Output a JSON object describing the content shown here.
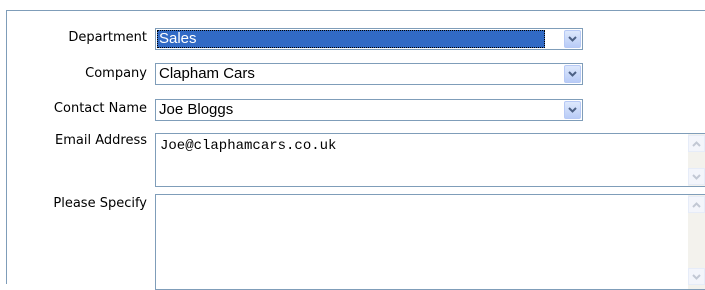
{
  "form": {
    "department": {
      "label": "Department",
      "value": "Sales",
      "selected_highlight": true,
      "dropdown_icon": "chevron-down-icon"
    },
    "company": {
      "label": "Company",
      "value": "Clapham Cars",
      "dropdown_icon": "chevron-down-icon"
    },
    "contact_name": {
      "label": "Contact Name",
      "value": "Joe Bloggs",
      "dropdown_icon": "chevron-down-icon"
    },
    "email_address": {
      "label": "Email Address",
      "value": "Joe@claphamcars.co.uk",
      "scroll_icons": [
        "scroll-up-icon",
        "scroll-down-icon"
      ]
    },
    "please_specify": {
      "label": "Please Specify",
      "value": "",
      "scroll_icons": [
        "scroll-up-icon",
        "scroll-down-icon"
      ]
    }
  },
  "colors": {
    "border": "#7f9db9",
    "selection": "#316ac5",
    "dropdown_arrow": "#4d6185",
    "scroll_arrow": "#c2c8d4"
  }
}
